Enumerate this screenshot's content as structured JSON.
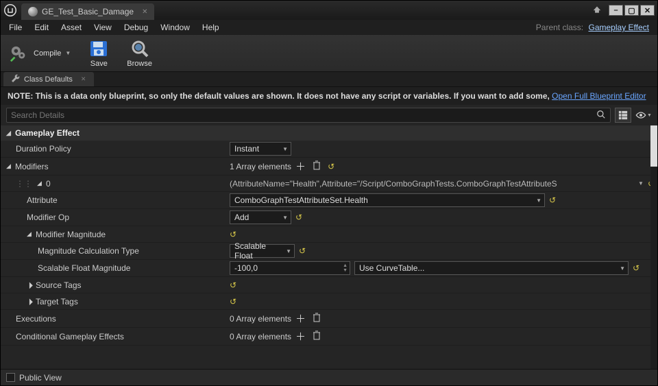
{
  "window": {
    "asset_name": "GE_Test_Basic_Damage",
    "parent_class_label": "Parent class:",
    "parent_class": "Gameplay Effect"
  },
  "menu": {
    "file": "File",
    "edit": "Edit",
    "asset": "Asset",
    "view": "View",
    "debug": "Debug",
    "window": "Window",
    "help": "Help"
  },
  "toolbar": {
    "compile": "Compile",
    "save": "Save",
    "browse": "Browse"
  },
  "tabs": {
    "class_defaults": "Class Defaults"
  },
  "note": {
    "prefix": "NOTE: This is a data only blueprint, so only the default values are shown.  It does not have any script or variables.  If you want to add some, ",
    "link": "Open Full Blueprint Editor"
  },
  "search": {
    "placeholder": "Search Details"
  },
  "section": {
    "gameplay_effect": "Gameplay Effect"
  },
  "rows": {
    "duration_policy": "Duration Policy",
    "duration_value": "Instant",
    "modifiers": "Modifiers",
    "modifiers_count": "1 Array elements",
    "idx0": "0",
    "idx0_value": "(AttributeName=\"Health\",Attribute=\"/Script/ComboGraphTests.ComboGraphTestAttributeS",
    "attribute": "Attribute",
    "attribute_value": "ComboGraphTestAttributeSet.Health",
    "modifier_op": "Modifier Op",
    "modifier_op_value": "Add",
    "modifier_magnitude": "Modifier Magnitude",
    "mag_calc": "Magnitude Calculation Type",
    "mag_calc_value": "Scalable Float",
    "scalable": "Scalable Float Magnitude",
    "scalable_value": "-100,0",
    "curve": "Use CurveTable...",
    "source_tags": "Source Tags",
    "target_tags": "Target Tags",
    "executions": "Executions",
    "zero_elements": "0 Array elements",
    "conditional": "Conditional Gameplay Effects"
  },
  "footer": {
    "public_view": "Public View"
  }
}
